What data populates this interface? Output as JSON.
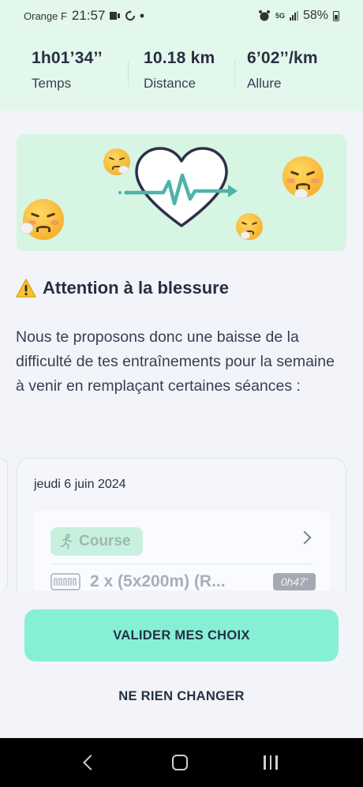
{
  "status_bar": {
    "carrier": "Orange F",
    "time": "21:57",
    "network": "5G",
    "battery": "58%"
  },
  "stats": [
    {
      "value": "1h01’34’’",
      "label": "Temps"
    },
    {
      "value": "10.18 km",
      "label": "Distance"
    },
    {
      "value": "6’02’’/km",
      "label": "Allure"
    }
  ],
  "warning": {
    "title": "Attention à la blessure",
    "description": "Nous te proposons donc une baisse de la difficulté de tes entraînements pour la semaine à venir en remplaçant certaines séances :"
  },
  "session_card": {
    "date": "jeudi 6 juin 2024",
    "activity_label": "Course",
    "session_title": "2 x (5x200m) (R...",
    "duration": "0h47’"
  },
  "actions": {
    "validate_label": "VALIDER MES CHOIX",
    "skip_label": "NE RIEN CHANGER"
  },
  "colors": {
    "header_bg": "#e3f8ec",
    "primary_button": "#86f0d6",
    "heart_line": "#4fb3a9",
    "text_dark": "#2b2d42"
  },
  "icons": {
    "illustration": [
      "heart-pulse-icon",
      "sick-face-emoji"
    ],
    "warning": "warning-icon",
    "activity": "runner-icon",
    "session": "intervals-icon",
    "chevron": "chevron-right-icon"
  }
}
